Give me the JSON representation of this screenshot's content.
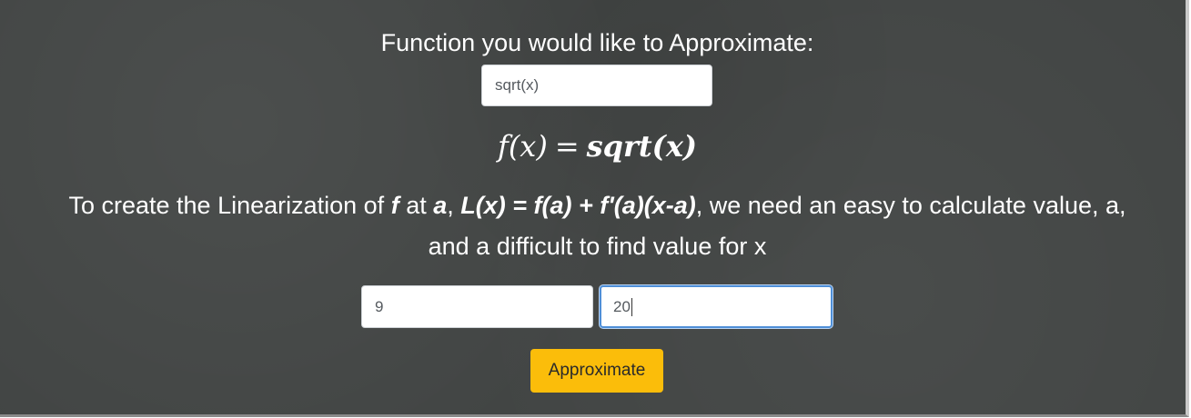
{
  "heading": "Function you would like to Approximate:",
  "function_input": {
    "value": "sqrt(x)"
  },
  "formula": {
    "lhs": "f(x)",
    "equals": "=",
    "rhs": "sqrt(x)"
  },
  "description": {
    "part1": "To create the Linearization of ",
    "f": "f",
    "at": " at ",
    "a": "a",
    "comma": ", ",
    "formula": "L(x) = f(a) + f'(a)(x-a)",
    "part2": ", we need an easy to calculate value, a, and a difficult to find value for x"
  },
  "a_input": {
    "value": "9"
  },
  "x_input": {
    "value": "20"
  },
  "approximate_button": {
    "label": "Approximate",
    "color": "#fbbd0a"
  },
  "colors": {
    "background": "#424544",
    "text": "#ffffff",
    "focus": "#4f8fd8"
  }
}
